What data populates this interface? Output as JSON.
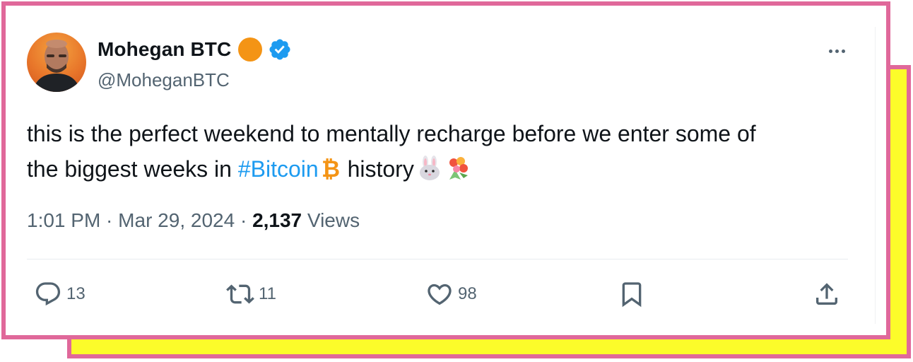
{
  "tweet": {
    "author": {
      "display_name": "Mohegan BTC",
      "handle": "@MoheganBTC",
      "verified": true,
      "badge_color": "#f49415"
    },
    "text": {
      "line1": "this is the perfect weekend to mentally recharge before we enter some of",
      "line2_before": "the biggest weeks in ",
      "hashtag": "#Bitcoin",
      "line2_after": " history"
    },
    "emojis": [
      "bitcoin-emoji",
      "rabbit-emoji",
      "bouquet-emoji"
    ],
    "meta": {
      "time": "1:01 PM",
      "sep1": " · ",
      "date": "Mar 29, 2024",
      "sep2": " · ",
      "views_count": "2,137",
      "views_label": " Views"
    },
    "actions": {
      "replies": "13",
      "retweets": "11",
      "likes": "98"
    }
  },
  "colors": {
    "frame_border": "#e0689a",
    "frame_fill": "#fcfc2a",
    "accent_blue": "#1d9bf0",
    "secondary_text": "#536471",
    "primary_text": "#0f1419"
  }
}
